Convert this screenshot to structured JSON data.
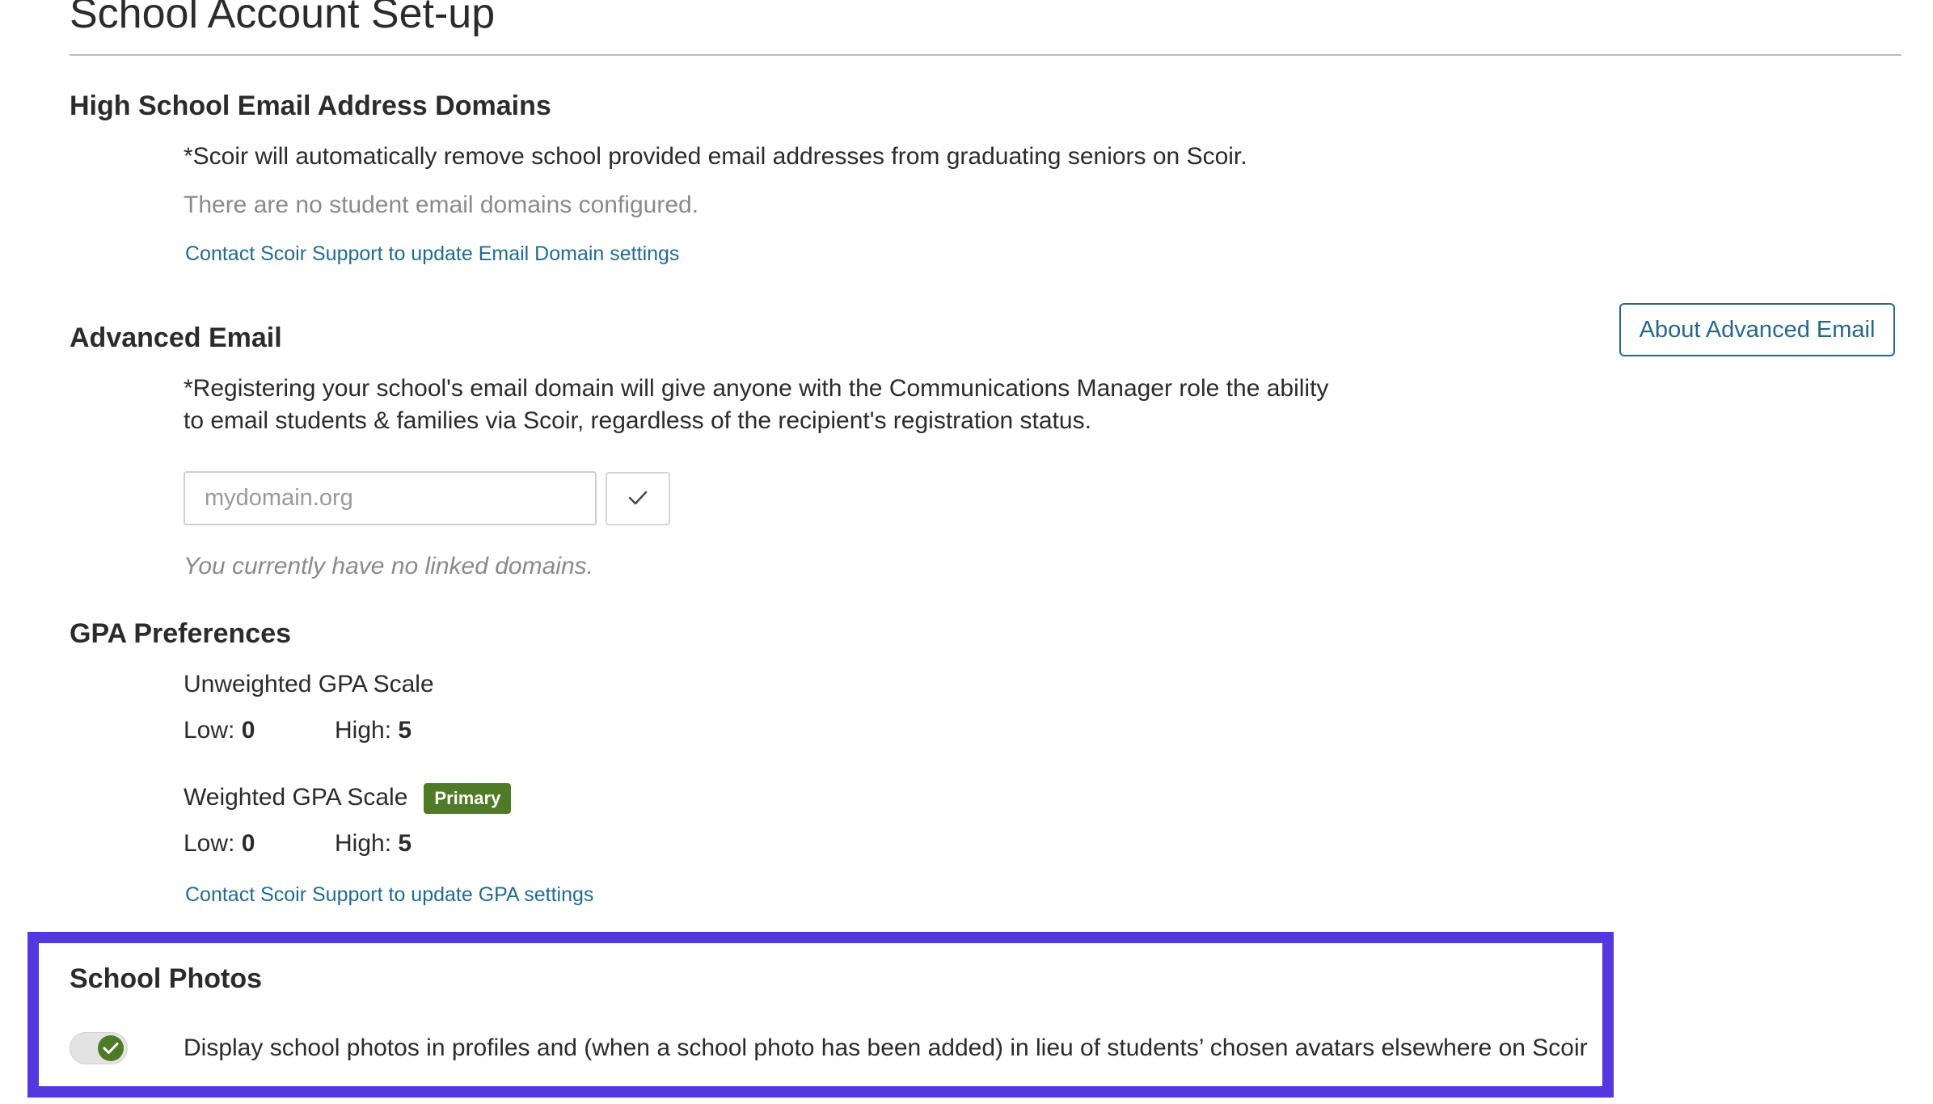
{
  "page": {
    "title": "School Account Set-up"
  },
  "email_domains": {
    "heading": "High School Email Address Domains",
    "note": "*Scoir will automatically remove school provided email addresses from graduating seniors on Scoir.",
    "empty_state": "There are no student email domains configured.",
    "support_link": "Contact Scoir Support to update Email Domain settings"
  },
  "advanced_email": {
    "heading": "Advanced Email",
    "about_button": "About Advanced Email",
    "note_line1": "*Registering your school's email domain will give anyone with the Communications Manager role the ability",
    "note_line2": "to email students & families via Scoir, regardless of the recipient's registration status.",
    "input_value": "",
    "input_placeholder": "mydomain.org",
    "confirm_icon": "check-icon",
    "empty_state": "You currently have no linked domains."
  },
  "gpa": {
    "heading": "GPA Preferences",
    "unweighted": {
      "label": "Unweighted GPA Scale",
      "low_label": "Low:",
      "low": "0",
      "high_label": "High:",
      "high": "5"
    },
    "weighted": {
      "label": "Weighted GPA Scale",
      "badge": "Primary",
      "low_label": "Low:",
      "low": "0",
      "high_label": "High:",
      "high": "5"
    },
    "support_link": "Contact Scoir Support to update GPA settings"
  },
  "school_photos": {
    "heading": "School Photos",
    "toggle_on": true,
    "toggle_icon": "check-icon",
    "description": "Display school photos in profiles and (when a school photo has been added) in lieu of students’ chosen avatars elsewhere on Scoir"
  },
  "colors": {
    "link": "#1f6c92",
    "button_outline": "#27678d",
    "badge": "#4f7a28",
    "highlight_border": "#5438df"
  }
}
